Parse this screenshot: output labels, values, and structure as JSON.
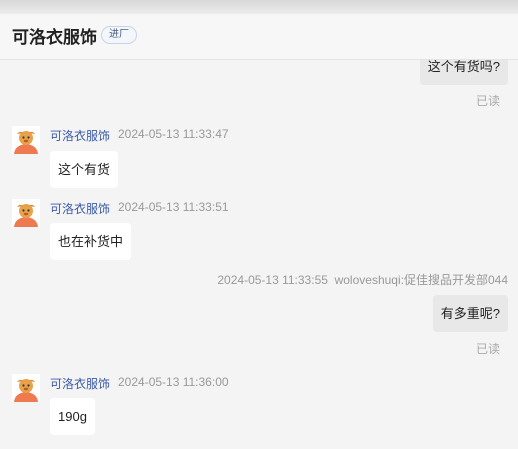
{
  "header": {
    "title": "可洛衣服饰",
    "badge": "进厂"
  },
  "messages": [
    {
      "text": "这个有货吗?",
      "status": "已读"
    },
    {
      "sender": "可洛衣服饰",
      "time": "2024-05-13 11:33:47",
      "text": "这个有货"
    },
    {
      "sender": "可洛衣服饰",
      "time": "2024-05-13 11:33:51",
      "text": "也在补货中"
    },
    {
      "time": "2024-05-13 11:33:55",
      "sender": "woloveshuqi:促佳搜品开发部044",
      "text": "有多重呢?",
      "status": "已读"
    },
    {
      "sender": "可洛衣服饰",
      "time": "2024-05-13 11:36:00",
      "text": "190g"
    }
  ],
  "colors": {
    "sender_name": "#3a5aa8",
    "bubble_in": "#ffffff",
    "bubble_out": "#e8e8e8",
    "avatar_bg": "#f07a4f"
  }
}
